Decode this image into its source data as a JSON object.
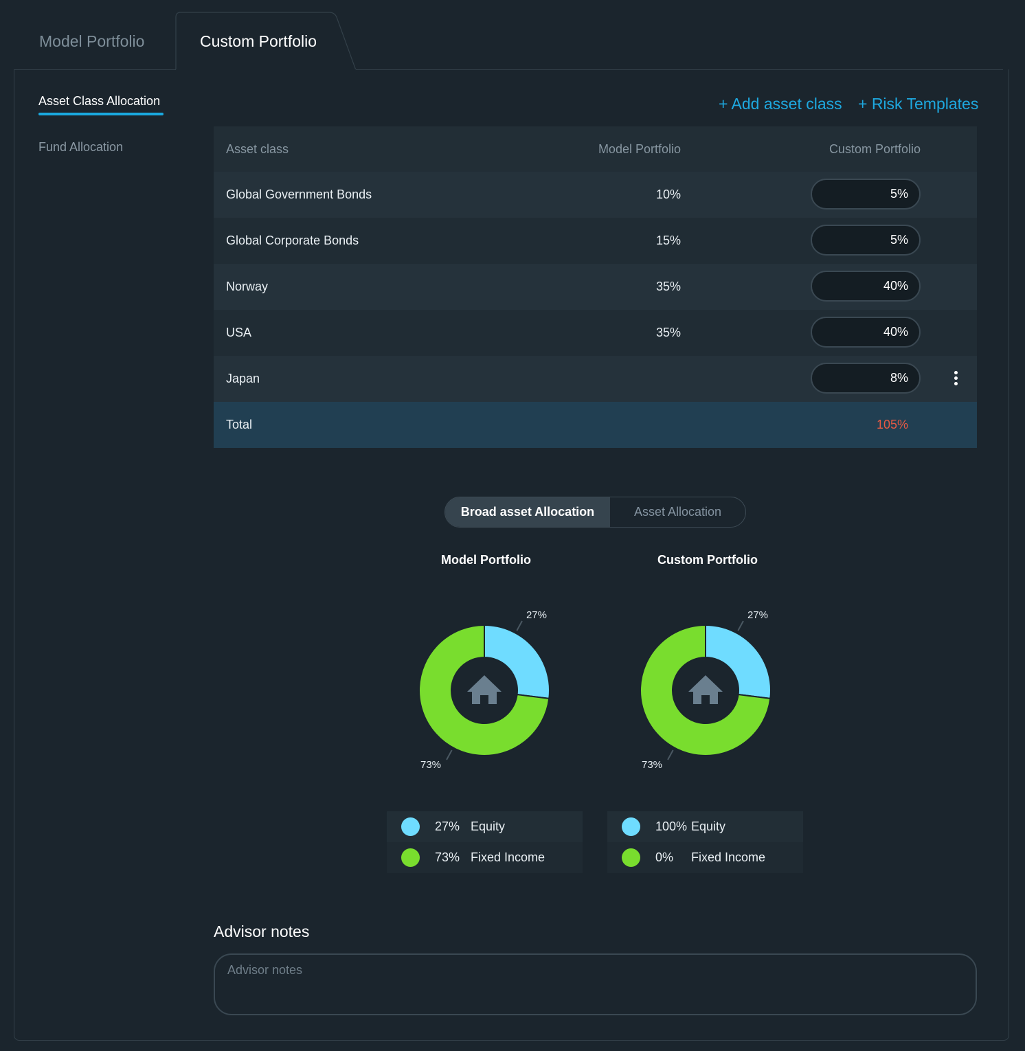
{
  "tabs": {
    "model_portfolio": "Model Portfolio",
    "custom_portfolio": "Custom Portfolio",
    "active": "custom_portfolio"
  },
  "side_nav": {
    "items": [
      "Asset Class Allocation",
      "Fund Allocation"
    ],
    "active": "Asset Class Allocation"
  },
  "actions": {
    "add_asset_class": "+ Add asset class",
    "risk_templates": "+ Risk Templates"
  },
  "table": {
    "headers": {
      "asset_class": "Asset class",
      "model": "Model Portfolio",
      "custom": "Custom Portfolio"
    },
    "rows": [
      {
        "name": "Global Government Bonds",
        "model": "10%",
        "custom": "5%"
      },
      {
        "name": "Global Corporate Bonds",
        "model": "15%",
        "custom": "5%"
      },
      {
        "name": "Norway",
        "model": "35%",
        "custom": "40%"
      },
      {
        "name": "USA",
        "model": "35%",
        "custom": "40%"
      },
      {
        "name": "Japan",
        "model": "",
        "custom": "8%"
      }
    ],
    "total": {
      "label": "Total",
      "value": "105%",
      "value_color": "#e75a44"
    }
  },
  "view_toggle": {
    "options": [
      "Broad asset Allocation",
      "Asset Allocation"
    ],
    "selected": "Broad asset Allocation"
  },
  "charts": {
    "model": {
      "title": "Model Portfolio",
      "slice_labels": [
        "27%",
        "73%"
      ]
    },
    "custom": {
      "title": "Custom Portfolio",
      "slice_labels": [
        "27%",
        "73%"
      ]
    },
    "center_icon": "home-icon"
  },
  "chart_data": [
    {
      "type": "pie",
      "title": "Model Portfolio",
      "categories": [
        "Equity",
        "Fixed Income"
      ],
      "values": [
        27,
        73
      ],
      "colors": [
        "#6fdcff",
        "#79dd2e"
      ],
      "donut": true
    },
    {
      "type": "pie",
      "title": "Custom Portfolio",
      "categories": [
        "Equity",
        "Fixed Income"
      ],
      "values": [
        27,
        73
      ],
      "colors": [
        "#6fdcff",
        "#79dd2e"
      ],
      "donut": true
    }
  ],
  "legends": {
    "model": [
      {
        "pct": "27%",
        "name": "Equity",
        "color": "#6fdcff"
      },
      {
        "pct": "73%",
        "name": "Fixed Income",
        "color": "#79dd2e"
      }
    ],
    "custom": [
      {
        "pct": "100%",
        "name": "Equity",
        "color": "#6fdcff"
      },
      {
        "pct": "0%",
        "name": "Fixed Income",
        "color": "#79dd2e"
      }
    ]
  },
  "advisor_notes": {
    "title": "Advisor notes",
    "placeholder": "Advisor notes",
    "value": ""
  },
  "colors": {
    "accent": "#1ea8df",
    "equity": "#6fdcff",
    "fixed_income": "#79dd2e",
    "error": "#e75a44"
  }
}
